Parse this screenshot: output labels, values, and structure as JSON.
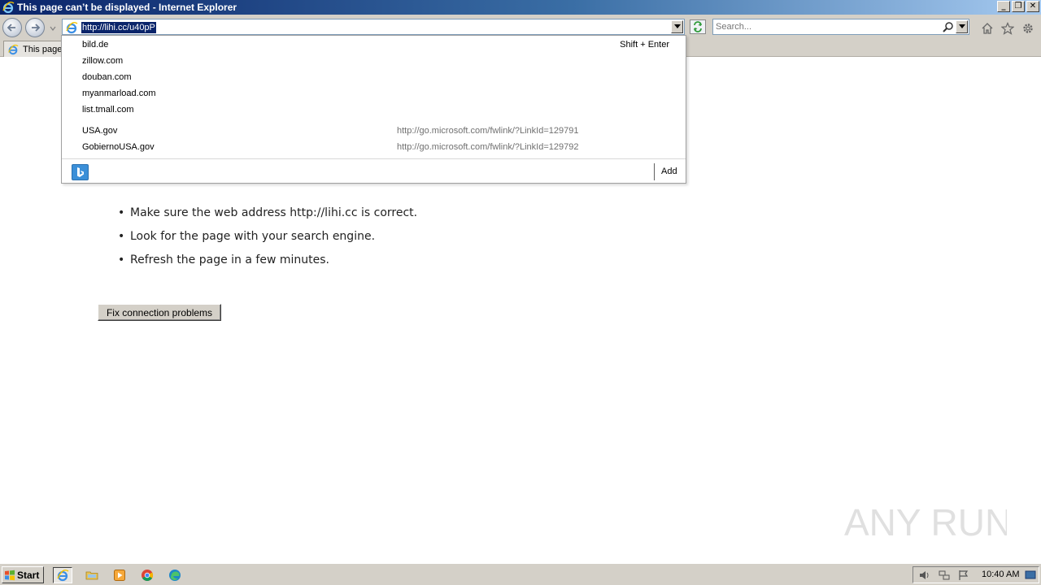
{
  "window": {
    "title": "This page can’t be displayed - Internet Explorer"
  },
  "navbar": {
    "address_url": "http://lihi.cc/u40pP",
    "search_placeholder": "Search..."
  },
  "tabs": [
    {
      "label": "This page"
    }
  ],
  "autocomplete": {
    "shortcut_hint": "Shift + Enter",
    "history": [
      "bild.de",
      "zillow.com",
      "douban.com",
      "myanmarload.com",
      "list.tmall.com"
    ],
    "favorites": [
      {
        "name": "USA.gov",
        "url": "http://go.microsoft.com/fwlink/?LinkId=129791"
      },
      {
        "name": "GobiernoUSA.gov",
        "url": "http://go.microsoft.com/fwlink/?LinkId=129792"
      }
    ],
    "add_label": "Add"
  },
  "page": {
    "bullets": [
      "Make sure the web address http://lihi.cc is correct.",
      "Look for the page with your search engine.",
      "Refresh the page in a few minutes."
    ],
    "fix_button": "Fix connection problems"
  },
  "watermark": {
    "text": "ANY RUN"
  },
  "taskbar": {
    "start_label": "Start",
    "clock": "10:40 AM",
    "quick_launch": [
      "ie-icon",
      "folder-icon",
      "media-player-icon",
      "chrome-icon",
      "edge-icon"
    ]
  },
  "colors": {
    "titlebar_start": "#0a246a",
    "titlebar_end": "#a6caf0",
    "chrome_gray": "#d4d0c8",
    "selection": "#0a246a",
    "bing_blue": "#3b8fd8"
  }
}
